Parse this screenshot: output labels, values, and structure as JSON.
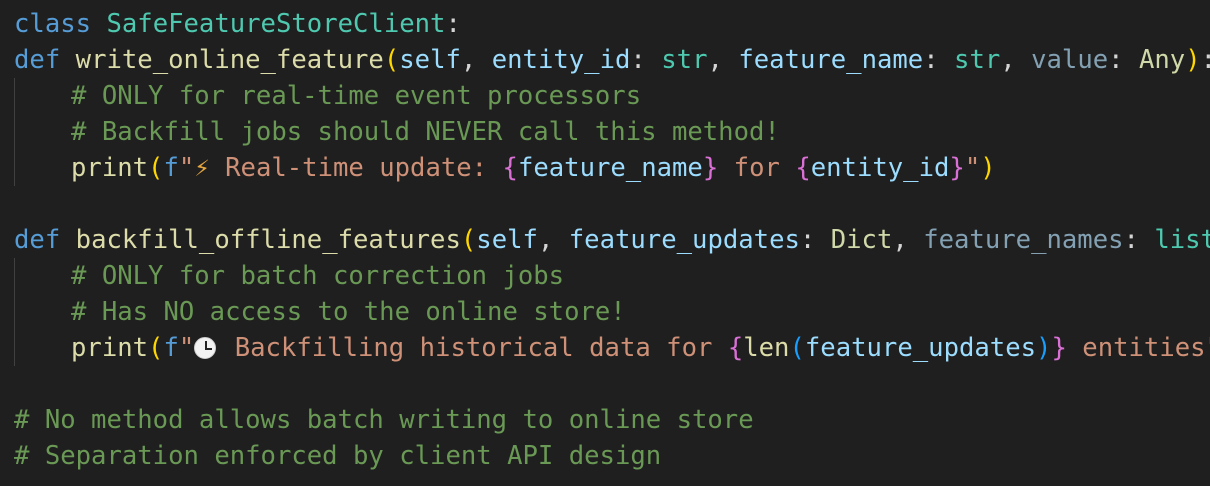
{
  "code": {
    "l1": {
      "kw": "class",
      "name": "SafeFeatureStoreClient",
      "colon": ":"
    },
    "l2": {
      "kw": "def",
      "fn": "write_online_feature",
      "open": "(",
      "self": "self",
      "c1": ", ",
      "p1": "entity_id",
      "p1c": ": ",
      "t1": "str",
      "c2": ", ",
      "p2": "feature_name",
      "p2c": ": ",
      "t2": "str",
      "c3": ", ",
      "p3": "value",
      "p3c": ": ",
      "t3": "Any",
      "close": ")",
      "colon": ":"
    },
    "l3": {
      "comment": "# ONLY for real-time event processors"
    },
    "l4": {
      "comment": "# Backfill jobs should NEVER call this method!"
    },
    "l5": {
      "fn": "print",
      "open": "(",
      "fpre": "f",
      "s1": "\"",
      "emoji": "⚡",
      "s2": " Real-time update: ",
      "b1o": "{",
      "v1": "feature_name",
      "b1c": "}",
      "s3": " for ",
      "b2o": "{",
      "v2": "entity_id",
      "b2c": "}",
      "s4": "\"",
      "close": ")"
    },
    "l7": {
      "kw": "def",
      "fn": "backfill_offline_features",
      "open": "(",
      "self": "self",
      "c1": ", ",
      "p1": "feature_updates",
      "p1c": ": ",
      "t1": "Dict",
      "c2": ", ",
      "p2": "feature_names",
      "p2c": ": ",
      "t2": "list",
      "close": ")",
      "colon": ":"
    },
    "l8": {
      "comment": "# ONLY for batch correction jobs"
    },
    "l9": {
      "comment": "# Has NO access to the online store!"
    },
    "l10": {
      "fn": "print",
      "open": "(",
      "fpre": "f",
      "s1": "\"",
      "s2": " Backfilling historical data for ",
      "bo": "{",
      "len": "len",
      "lo": "(",
      "v": "feature_updates",
      "lc": ")",
      "bc": "}",
      "s3": " entities",
      "s4": "\"",
      "close": ")"
    },
    "l12": {
      "comment": "# No method allows batch writing to online store"
    },
    "l13": {
      "comment": "# Separation enforced by client API design"
    }
  }
}
